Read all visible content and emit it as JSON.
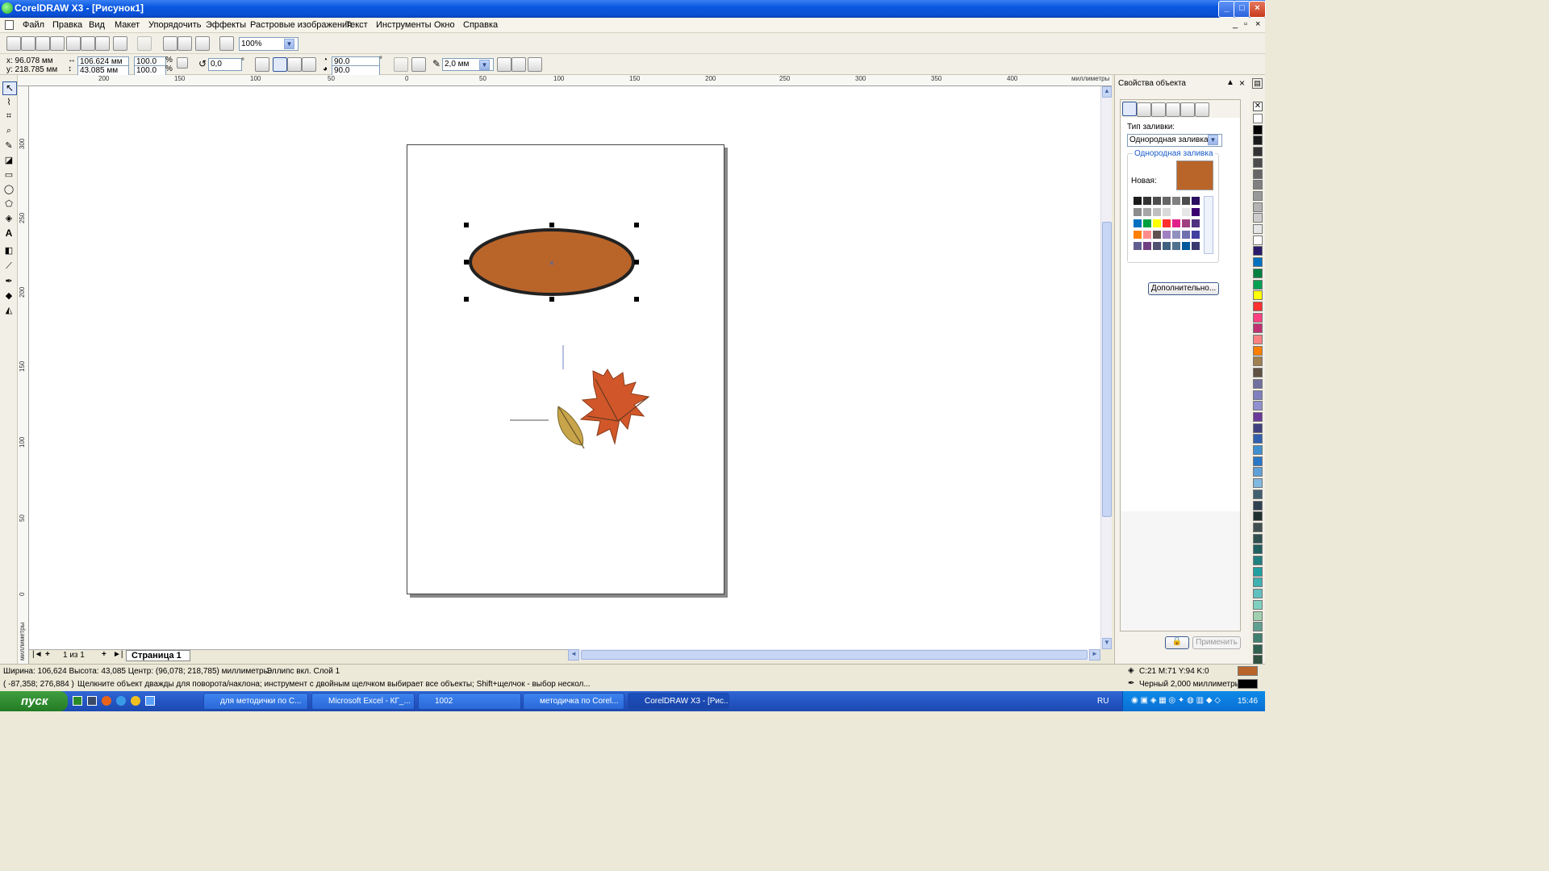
{
  "window": {
    "title": "CorelDRAW X3 - [Рисунок1]",
    "min": "_",
    "max": "□",
    "close": "×"
  },
  "menu": [
    "Файл",
    "Правка",
    "Вид",
    "Макет",
    "Упорядочить",
    "Эффекты",
    "Растровые изображения",
    "Текст",
    "Инструменты",
    "Окно",
    "Справка"
  ],
  "toolbar": {
    "zoom": "100%"
  },
  "property_bar": {
    "x": "x: 96.078 мм",
    "y": "y: 218.785 мм",
    "width": "106.624 мм",
    "height": "43.085 мм",
    "scale_x": "100.0",
    "scale_y": "100.0",
    "percent": "%",
    "rotation": "0,0",
    "degree": "°",
    "start_angle": "90.0",
    "end_angle": "90.0",
    "outline_width": "2,0 мм"
  },
  "ruler": {
    "unit": "миллиметры",
    "h_ticks": [
      "200",
      "150",
      "100",
      "50",
      "0",
      "50",
      "100",
      "150",
      "200",
      "250",
      "300",
      "350",
      "400"
    ],
    "v_ticks": [
      "300",
      "250",
      "200",
      "150",
      "100",
      "50",
      "0"
    ]
  },
  "pagebar": {
    "page_count": "1 из 1",
    "tab": "Страница 1"
  },
  "docker": {
    "title": "Свойства объекта",
    "fill_type_label": "Тип заливки:",
    "fill_type_value": "Однородная заливка",
    "group_label": "Однородная заливка",
    "new_label": "Новая:",
    "new_color": "#b9652a",
    "more_button": "Дополнительно...",
    "apply_button": "Применить",
    "mini_palette": [
      "#1a1a1a",
      "#333333",
      "#4d4d4d",
      "#666666",
      "#808080",
      "#4d4d4d",
      "#2b0f61",
      "#8c8c8c",
      "#a6a6a6",
      "#bfbfbf",
      "#d9d9d9",
      "#ffffff",
      "#e6e6e6",
      "#3a0070",
      "#0070c0",
      "#00a040",
      "#ffff00",
      "#ff3030",
      "#e0208a",
      "#a04080",
      "#503080",
      "#ff8000",
      "#ff8c8c",
      "#605050",
      "#a080c0",
      "#9090c0",
      "#7070b0",
      "#4040a0",
      "#606090",
      "#704080",
      "#505070",
      "#406080",
      "#507090",
      "#005a9a",
      "#3a3a70"
    ]
  },
  "palette": [
    "#ffffff",
    "#000000",
    "#1a1a1a",
    "#333333",
    "#4d4d4d",
    "#666666",
    "#808080",
    "#999999",
    "#b3b3b3",
    "#cccccc",
    "#e6e6e6",
    "#ffffff",
    "#2a1a6a",
    "#0070c0",
    "#008040",
    "#00a050",
    "#ffff00",
    "#ff3030",
    "#ff4080",
    "#c03070",
    "#ff8080",
    "#ff8000",
    "#a08050",
    "#605040",
    "#7070a0",
    "#8080c0",
    "#9090d0",
    "#6a3a9a",
    "#404080",
    "#3060b0",
    "#4090d0",
    "#2a78c8",
    "#60a0d8",
    "#80b8e0",
    "#406070",
    "#304050",
    "#203030",
    "#405050",
    "#305050",
    "#206060",
    "#208080",
    "#20a0a0",
    "#40b0b0",
    "#60c0c0",
    "#80d0c0",
    "#a0d0b0",
    "#60a090",
    "#408070",
    "#306050",
    "#305040"
  ],
  "status": {
    "line1": "Ширина: 106,624  Высота: 43,085  Центр: (96,078; 218,785)  миллиметры",
    "object": "Эллипс вкл. Слой 1",
    "coords": "( -87,358; 276,884 )",
    "hint": "Щелкните объект дважды для поворота/наклона; инструмент с двойным щелчком выбирает все объекты; Shift+щелчок - выбор нескол...",
    "fill_info": "C:21 M:71 Y:94 K:0",
    "outline_info": "Черный  2,000 миллиметры",
    "fill_color": "#b9652a",
    "outline_color": "#000000"
  },
  "taskbar": {
    "start": "пуск",
    "tasks": [
      "для методички по С...",
      "Microsoft Excel - КГ_...",
      "1002",
      "методичка по Corel...",
      "CorelDRAW X3 - [Рис..."
    ],
    "lang": "RU",
    "time": "15:46"
  },
  "drawing": {
    "ellipse_fill": "#b9652a",
    "ellipse_stroke": "#222222"
  }
}
